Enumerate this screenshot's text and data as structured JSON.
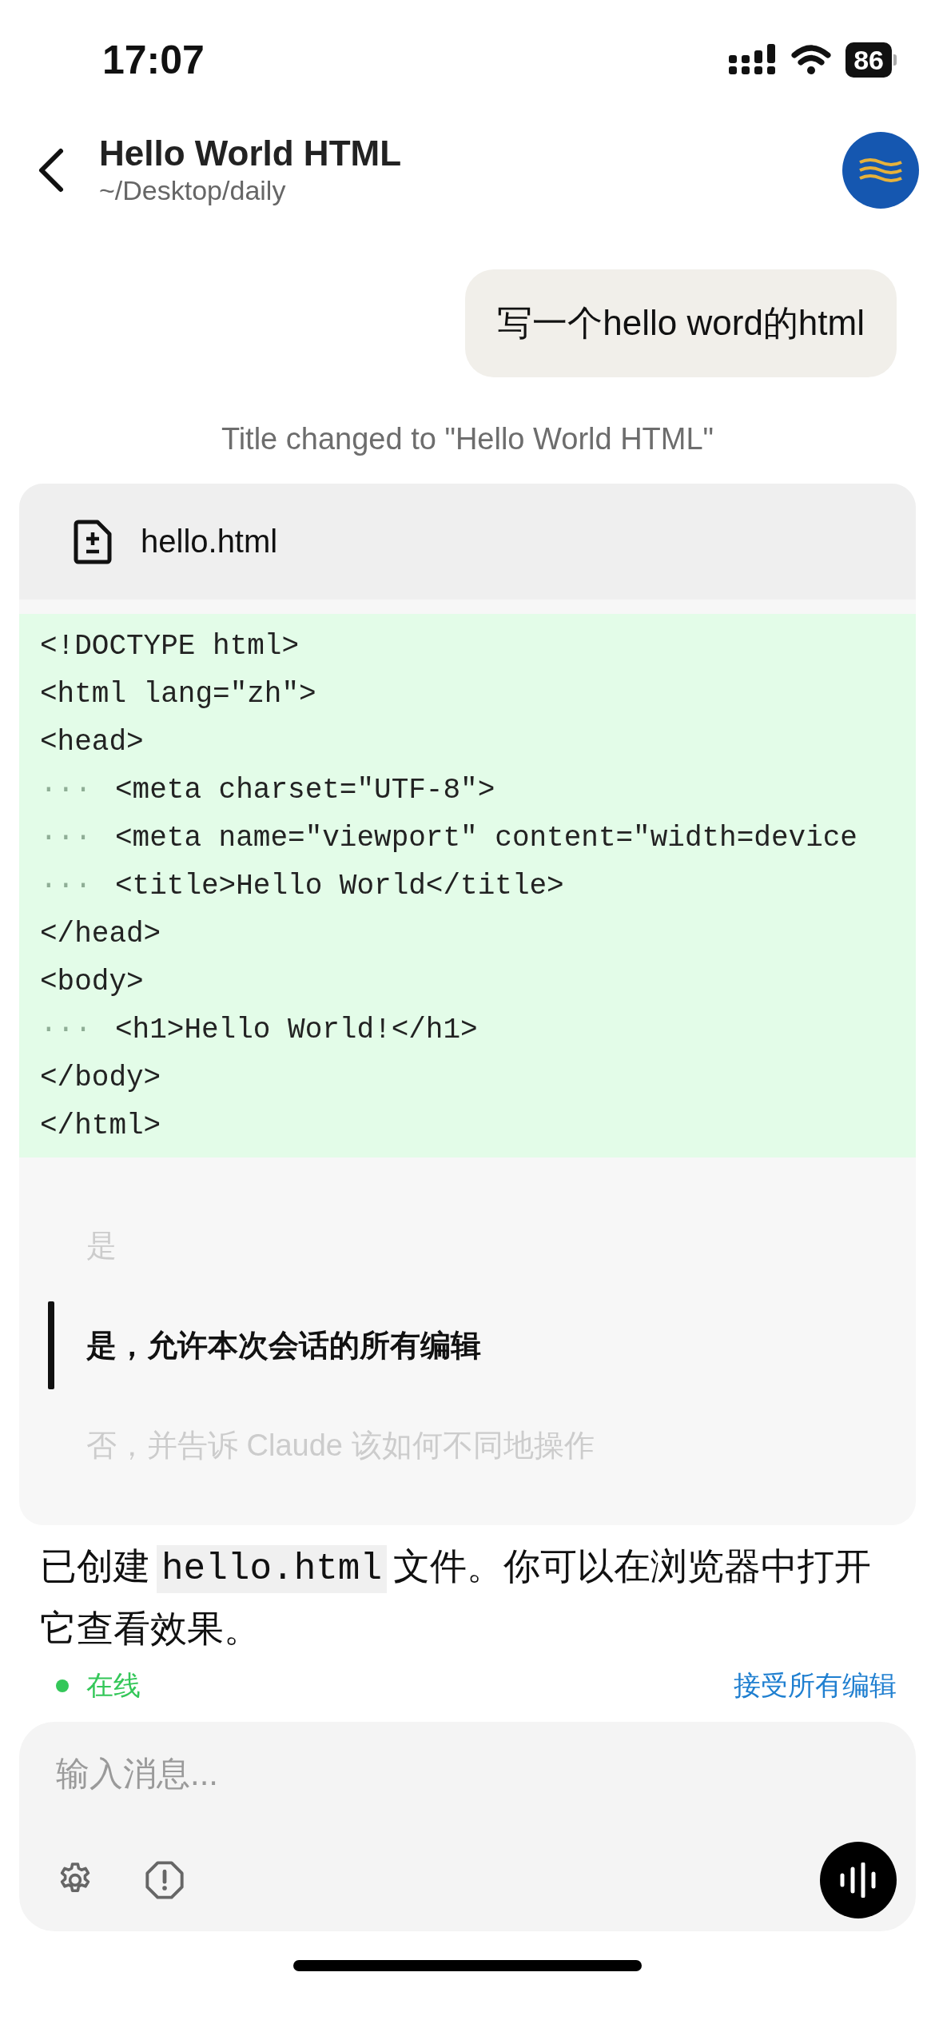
{
  "status_bar": {
    "time": "17:07",
    "battery": "86"
  },
  "header": {
    "title": "Hello World HTML",
    "subtitle": "~/Desktop/daily"
  },
  "user_message": "写一个hello word的html",
  "system_note": "Title changed to \"Hello World HTML\"",
  "file_card": {
    "filename": "hello.html",
    "lines": [
      {
        "code": "<!DOCTYPE html>"
      },
      {
        "code": "<html lang=\"zh\">"
      },
      {
        "code": "<head>"
      },
      {
        "indent": "···",
        "code": "<meta charset=\"UTF-8\">"
      },
      {
        "indent": "···",
        "code": "<meta name=\"viewport\" content=\"width=device"
      },
      {
        "indent": "···",
        "code": "<title>Hello World</title>"
      },
      {
        "code": "</head>"
      },
      {
        "code": "<body>"
      },
      {
        "indent": "···",
        "code": "<h1>Hello World!</h1>"
      },
      {
        "code": "</body>"
      },
      {
        "code": "</html>"
      }
    ],
    "options": [
      {
        "label": "是",
        "selected": false
      },
      {
        "label": "是，允许本次会话的所有编辑",
        "selected": true
      },
      {
        "label": "否，并告诉 Claude 该如何不同地操作",
        "selected": false
      }
    ]
  },
  "reply": [
    {
      "kind": "text",
      "text": "已创建"
    },
    {
      "kind": "code",
      "text": "hello.html"
    },
    {
      "kind": "text",
      "text": "文件。你可以在浏览器中打开它查看效果。"
    }
  ],
  "connection": {
    "label": "在线",
    "color": "#34c759"
  },
  "accept_all": "接受所有编辑",
  "composer": {
    "placeholder": "输入消息..."
  }
}
